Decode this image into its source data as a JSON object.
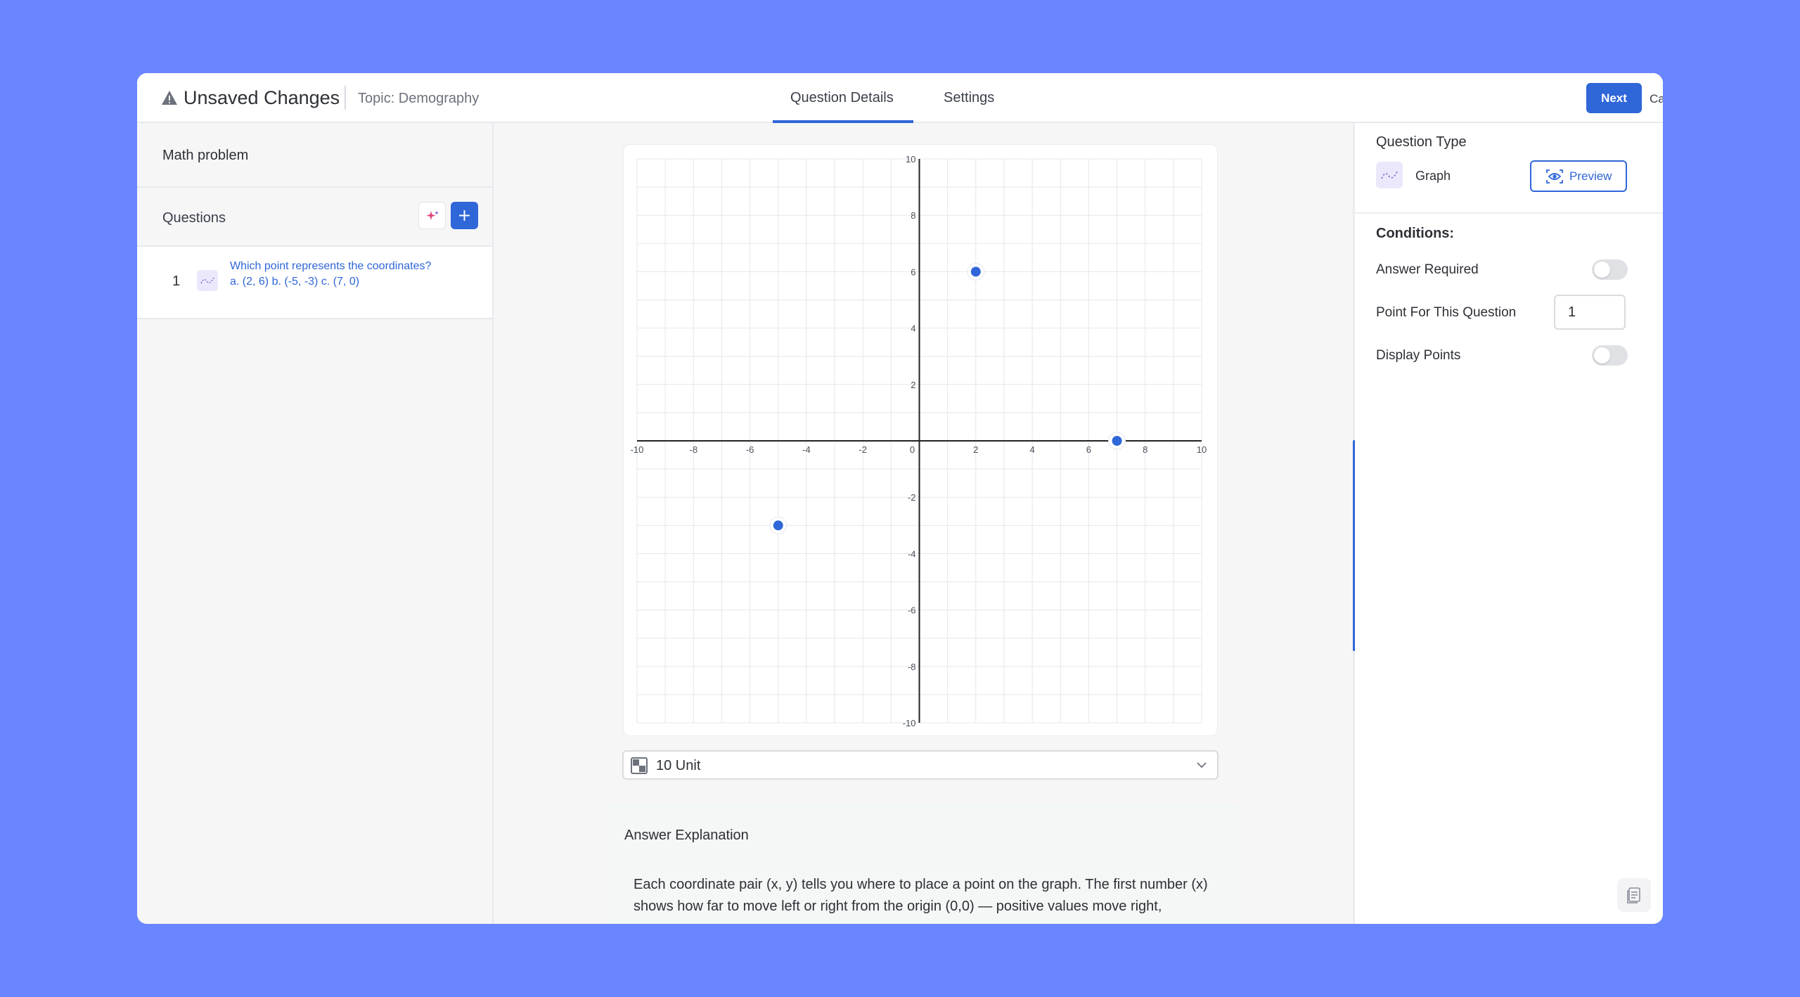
{
  "header": {
    "title": "Unsaved Changes",
    "topic": "Topic: Demography",
    "tabs": [
      {
        "label": "Question Details",
        "active": true
      },
      {
        "label": "Settings",
        "active": false
      }
    ],
    "cancel_label": "Cancel",
    "next_label": "Next",
    "accent_color": "#2f66d8"
  },
  "sidebar": {
    "title": "Math problem",
    "questions_label": "Questions",
    "questions": [
      {
        "number": "1",
        "icon": "graph-icon",
        "text": "Which point represents the coordinates? a. (2, 6) b. (-5, -3) c. (7, 0)"
      }
    ]
  },
  "main": {
    "unit_select_value": "10 Unit",
    "answer_explanation_title": "Answer Explanation",
    "answer_explanation_text": "Each coordinate pair (x, y) tells you where to place a point on the graph. The first number (x) shows how far to move left or right from the origin (0,0) — positive values move right,"
  },
  "chart_data": {
    "type": "scatter",
    "xlim": [
      -10,
      10
    ],
    "ylim": [
      -10,
      10
    ],
    "grid": true,
    "x_ticks": [
      -10,
      -8,
      -6,
      -4,
      -2,
      0,
      2,
      4,
      6,
      8,
      10
    ],
    "y_ticks": [
      10,
      8,
      6,
      4,
      2,
      -2,
      -4,
      -6,
      -8,
      -10
    ],
    "points": [
      {
        "x": 2,
        "y": 6
      },
      {
        "x": -5,
        "y": -3
      },
      {
        "x": 7,
        "y": 0
      }
    ],
    "point_color": "#2f66d8"
  },
  "settings_panel": {
    "question_type_label": "Question Type",
    "question_type_value": "Graph",
    "preview_label": "Preview",
    "conditions_label": "Conditions:",
    "answer_required_label": "Answer Required",
    "answer_required": false,
    "points_label": "Point For This Question",
    "points_value": "1",
    "display_points_label": "Display Points",
    "display_points": false
  }
}
